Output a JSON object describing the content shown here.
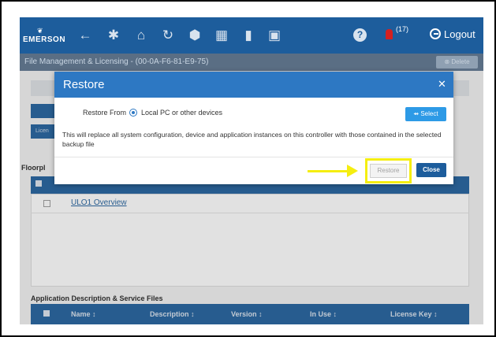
{
  "nav": {
    "logo_mark": "❦",
    "logo_text": "EMERSON",
    "icons": [
      {
        "name": "back-arrow-icon",
        "glyph": "←"
      },
      {
        "name": "gear-icon",
        "glyph": "✱"
      },
      {
        "name": "home-icon",
        "glyph": "⌂"
      },
      {
        "name": "refresh-icon",
        "glyph": "↻"
      },
      {
        "name": "cube-icon",
        "glyph": "⬢"
      },
      {
        "name": "calendar-icon",
        "glyph": "▦"
      },
      {
        "name": "map-icon",
        "glyph": "▮"
      },
      {
        "name": "panel-icon",
        "glyph": "▣"
      }
    ],
    "help_glyph": "?",
    "notification_count": "(17)",
    "logout_label": "Logout"
  },
  "subheader": {
    "title": "File Management & Licensing - (00-0A-F6-81-E9-75)",
    "delete_label": "⊗ Delete"
  },
  "page": {
    "floorplan_label": "Floorpl",
    "floorplan_row_link": "ULO1 Overview",
    "left_button_label": "Licen",
    "app_section_label": "Application Description & Service Files",
    "app_columns": [
      "Name ↕",
      "Description ↕",
      "Version ↕",
      "In Use ↕",
      "License Key ↕"
    ]
  },
  "modal": {
    "title": "Restore",
    "close_glyph": "✕",
    "restore_from_label": "Restore From",
    "radio_option_label": "Local PC or other devices",
    "select_label": "⇴ Select",
    "warning": "This will replace all system configuration, device and application instances on this controller with those contained in the selected backup file",
    "restore_button_label": "Restore",
    "close_button_label": "Close"
  },
  "colors": {
    "nav_blue": "#1d5d9c",
    "modal_header_blue": "#2d78c3",
    "highlight_yellow": "#f5ee10"
  }
}
